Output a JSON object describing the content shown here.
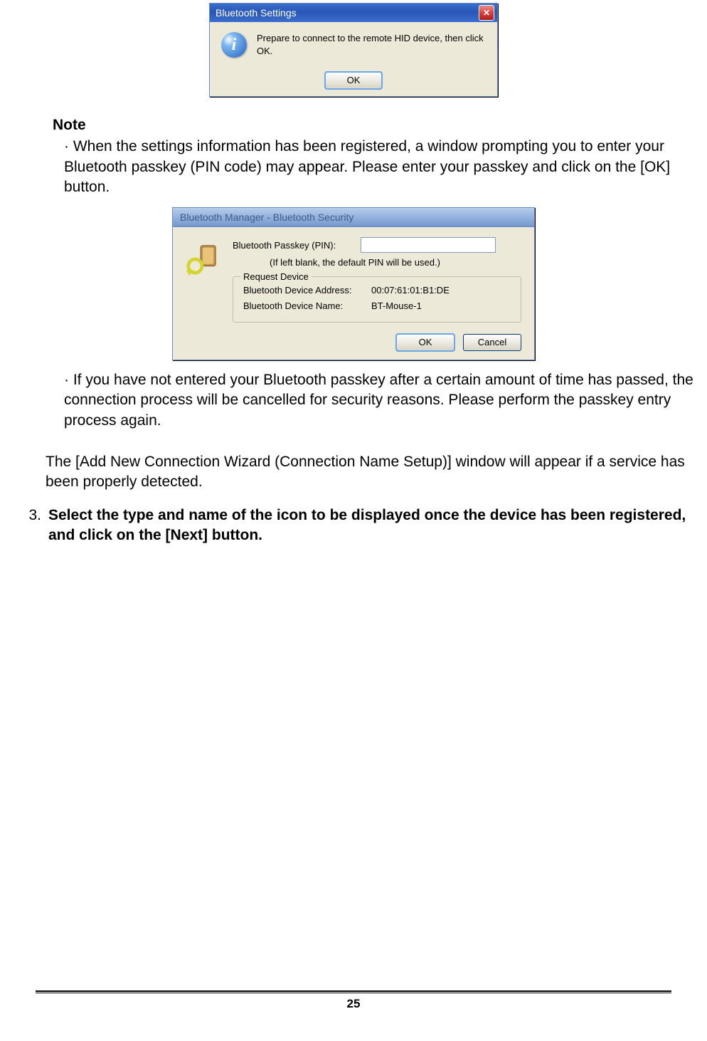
{
  "dialog1": {
    "title": "Bluetooth Settings",
    "message": "Prepare to connect to the remote HID device, then click OK.",
    "ok": "OK",
    "info_glyph": "i"
  },
  "note": {
    "heading": "Note",
    "item1": "· When the settings information has been registered, a window prompting you to enter your Bluetooth passkey (PIN code) may appear. Please enter your passkey and click on the [OK] button.",
    "item2": "· If you have not entered your Bluetooth passkey after a certain amount of time has passed, the connection process will be cancelled for security reasons. Please perform the passkey entry process again."
  },
  "dialog2": {
    "title": "Bluetooth Manager - Bluetooth Security",
    "passkey_label": "Bluetooth Passkey (PIN):",
    "hint": "(If left blank, the default PIN will be used.)",
    "fieldset_legend": "Request Device",
    "addr_label": "Bluetooth Device Address:",
    "addr_value": "00:07:61:01:B1:DE",
    "name_label": "Bluetooth Device Name:",
    "name_value": "BT-Mouse-1",
    "ok": "OK",
    "cancel": "Cancel"
  },
  "after": {
    "para": "The [Add New Connection Wizard (Connection Name Setup)] window will appear if a service has been properly detected."
  },
  "step": {
    "num": "3.",
    "text": "Select the type and name of the icon to be displayed once the device has been registered, and click on the [Next] button."
  },
  "page_number": "25"
}
